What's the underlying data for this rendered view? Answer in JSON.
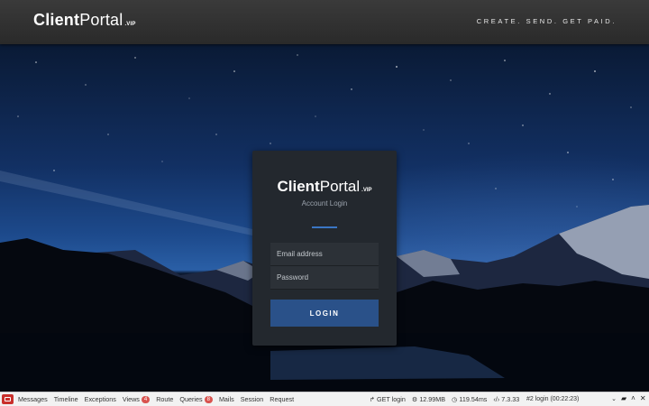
{
  "header": {
    "brand_client": "Client",
    "brand_portal": "Portal",
    "brand_vip": ".VIP",
    "tagline": "CREATE. SEND. GET PAID."
  },
  "card": {
    "brand_client": "Client",
    "brand_portal": "Portal",
    "brand_vip": ".VIP",
    "subtitle": "Account Login",
    "email_placeholder": "Email address",
    "password_placeholder": "Password",
    "login_label": "LOGIN",
    "accent_color": "#2a5189"
  },
  "debugbar": {
    "tabs": [
      {
        "label": "Messages"
      },
      {
        "label": "Timeline"
      },
      {
        "label": "Exceptions"
      },
      {
        "label": "Views",
        "badge": "4"
      },
      {
        "label": "Route"
      },
      {
        "label": "Queries",
        "badge": "8"
      },
      {
        "label": "Mails"
      },
      {
        "label": "Session"
      },
      {
        "label": "Request"
      }
    ],
    "request": "GET login",
    "memory": "12.99MB",
    "time": "119.54ms",
    "php_version": "7.3.33",
    "session_select": "#2 login (00:22:23)"
  }
}
